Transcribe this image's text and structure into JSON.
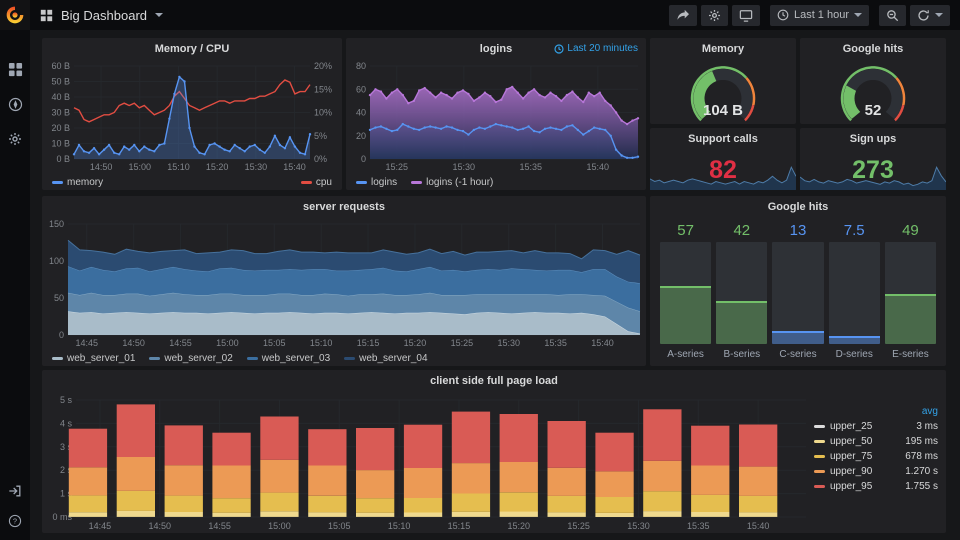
{
  "header": {
    "title": "Big Dashboard",
    "time_range": "Last 1 hour"
  },
  "sidebar": {
    "top_icons": [
      "apps-grid",
      "explore-compass",
      "settings-gear"
    ],
    "bottom_icons": [
      "sign-in",
      "help"
    ]
  },
  "colors": {
    "accent_blue": "#33a2e8",
    "green": "#73BF69",
    "blue": "#5794F2",
    "red": "#E24D42"
  },
  "chart_data": {
    "memory_cpu": {
      "type": "line",
      "title": "Memory / CPU",
      "x_start": "14:43",
      "x_end": "15:44",
      "x_ticks": [
        "14:50",
        "15:00",
        "15:10",
        "15:20",
        "15:30",
        "15:40"
      ],
      "y_left": {
        "ticks": [
          "0 B",
          "10 B",
          "20 B",
          "30 B",
          "40 B",
          "50 B",
          "60 B"
        ],
        "min": 0,
        "max": 60
      },
      "y_right": {
        "ticks": [
          "0%",
          "5%",
          "10%",
          "15%",
          "20%"
        ],
        "min": 0,
        "max": 20
      },
      "series": [
        {
          "name": "memory",
          "axis": "left",
          "color": "#5794F2",
          "fill": "rgba(87,148,242,0.28)",
          "points": true,
          "values": [
            3,
            9,
            5,
            4,
            7,
            3,
            6,
            9,
            4,
            3,
            8,
            6,
            9,
            5,
            8,
            6,
            5,
            9,
            10,
            26,
            42,
            53,
            50,
            20,
            8,
            4,
            3,
            9,
            10,
            8,
            6,
            5,
            9,
            7,
            5,
            8,
            9,
            6,
            4,
            8,
            15,
            9,
            7,
            14,
            8,
            4,
            3,
            16
          ]
        },
        {
          "name": "cpu",
          "axis": "right",
          "color": "#E24D42",
          "values": [
            11,
            10.5,
            8.5,
            8,
            8.5,
            9,
            9.5,
            9.5,
            10,
            11.5,
            12,
            11.5,
            12,
            11,
            11.5,
            10.5,
            9.5,
            10,
            10.5,
            11.5,
            13.5,
            14.5,
            13,
            11.5,
            11,
            10.5,
            11,
            11.5,
            12,
            12.5,
            12.5,
            12,
            12.5,
            12.5,
            12.5,
            13,
            13,
            13.5,
            13.5,
            14,
            14.5,
            16,
            17,
            16.5,
            14,
            14.5,
            14.5,
            16
          ]
        }
      ]
    },
    "logins": {
      "type": "line",
      "title": "logins",
      "header_note": "Last 20 minutes",
      "x_start": "15:23",
      "x_end": "15:43",
      "x_ticks": [
        "15:25",
        "15:30",
        "15:35",
        "15:40"
      ],
      "y_left": {
        "ticks": [
          "0",
          "20",
          "40",
          "60",
          "80"
        ],
        "min": 0,
        "max": 80
      },
      "series": [
        {
          "name": "logins",
          "color": "#5794F2",
          "points": true,
          "fill": "rgba(87,148,242,0.10)",
          "values": [
            25,
            27,
            28,
            26,
            24,
            25,
            30,
            28,
            26,
            25,
            27,
            28,
            27,
            26,
            28,
            27,
            25,
            24,
            21,
            25,
            27,
            26,
            28,
            30,
            29,
            28,
            27,
            25,
            26,
            28,
            24,
            23,
            26,
            27,
            26,
            25,
            28,
            29,
            25,
            21,
            24,
            27,
            26,
            25,
            20,
            8,
            3,
            1,
            1,
            2
          ]
        },
        {
          "name": "logins (-1 hour)",
          "color": "#B877D9",
          "points": true,
          "gradient": [
            "rgba(184,119,217,0.80)",
            "rgba(32,44,78,0.90)"
          ],
          "values": [
            55,
            60,
            58,
            52,
            57,
            60,
            55,
            48,
            50,
            59,
            61,
            57,
            53,
            57,
            55,
            52,
            57,
            59,
            56,
            50,
            53,
            57,
            54,
            49,
            51,
            60,
            62,
            57,
            52,
            57,
            60,
            55,
            53,
            57,
            54,
            50,
            55,
            58,
            53,
            49,
            57,
            54,
            57,
            50,
            46,
            40,
            33,
            30,
            33,
            35
          ]
        }
      ]
    },
    "memory_gauge": {
      "type": "gauge",
      "title": "Memory",
      "value": "104 B",
      "fraction": 0.42,
      "color": "#73BF69",
      "thresholds": [
        {
          "upto": 0.68,
          "color": "#73BF69"
        },
        {
          "upto": 0.88,
          "color": "#EF843C"
        },
        {
          "upto": 1,
          "color": "#E24D42"
        }
      ]
    },
    "google_gauge": {
      "type": "gauge",
      "title": "Google hits",
      "value": "52",
      "fraction": 0.26,
      "color": "#73BF69",
      "thresholds": [
        {
          "upto": 0.68,
          "color": "#73BF69"
        },
        {
          "upto": 0.88,
          "color": "#EF843C"
        },
        {
          "upto": 1,
          "color": "#E24D42"
        }
      ]
    },
    "support_calls": {
      "type": "stat",
      "title": "Support calls",
      "value": "82",
      "value_color": "#E02F44",
      "spark_line": "#4E7CA8",
      "spark_fill": "rgba(32,55,82,0.9)",
      "spark": [
        7,
        5,
        6,
        4,
        5,
        6,
        5,
        4,
        6,
        7,
        6,
        5,
        4,
        3,
        5,
        4,
        3,
        4,
        5,
        3,
        5,
        4,
        3,
        5,
        4,
        6,
        9,
        6,
        4,
        6,
        16,
        9
      ]
    },
    "sign_ups": {
      "type": "stat",
      "title": "Sign ups",
      "value": "273",
      "value_color": "#73BF69",
      "spark_line": "#4E7CA8",
      "spark_fill": "rgba(32,55,82,0.9)",
      "spark": [
        9,
        6,
        5,
        7,
        5,
        4,
        6,
        5,
        4,
        5,
        7,
        6,
        4,
        5,
        6,
        5,
        4,
        3,
        5,
        4,
        6,
        5,
        3,
        4,
        2,
        3,
        5,
        4,
        6,
        17,
        10,
        5
      ]
    },
    "server_requests": {
      "type": "stacked_area",
      "title": "server requests",
      "x_start": "14:43",
      "x_end": "15:44",
      "x_ticks": [
        "14:45",
        "14:50",
        "14:55",
        "15:00",
        "15:05",
        "15:10",
        "15:15",
        "15:20",
        "15:25",
        "15:30",
        "15:35",
        "15:40"
      ],
      "y_left": {
        "ticks": [
          "0",
          "50",
          "100",
          "150"
        ],
        "min": 0,
        "max": 150
      },
      "series": [
        {
          "name": "web_server_01",
          "color": "#A9BCC9",
          "edge": "#CBD9E2",
          "values": [
            32,
            30,
            31,
            29,
            30,
            31,
            30,
            29,
            30,
            31,
            30,
            30,
            29,
            30,
            31,
            30,
            29,
            30,
            30,
            31,
            30,
            29,
            30,
            30,
            29,
            30,
            31,
            30,
            29,
            30,
            30,
            31,
            30,
            29,
            28,
            30,
            31,
            30,
            29,
            30,
            31,
            30,
            30,
            29,
            30,
            28,
            25,
            15,
            5,
            2
          ]
        },
        {
          "name": "web_server_02",
          "color": "#5E86A9",
          "edge": "#86A9C4",
          "values": [
            25,
            24,
            26,
            25,
            24,
            25,
            26,
            24,
            25,
            26,
            25,
            24,
            25,
            26,
            25,
            24,
            25,
            24,
            26,
            25,
            24,
            25,
            26,
            25,
            24,
            25,
            24,
            26,
            25,
            24,
            25,
            26,
            24,
            25,
            26,
            25,
            24,
            25,
            26,
            25,
            24,
            25,
            24,
            26,
            25,
            26,
            28,
            30,
            32,
            30
          ]
        },
        {
          "name": "web_server_03",
          "color": "#3B6E9F",
          "edge": "#5E8FBE",
          "values": [
            36,
            33,
            35,
            34,
            32,
            34,
            35,
            33,
            34,
            35,
            34,
            33,
            32,
            34,
            35,
            34,
            33,
            34,
            32,
            33,
            34,
            35,
            33,
            32,
            34,
            33,
            34,
            35,
            33,
            32,
            34,
            35,
            33,
            34,
            32,
            33,
            34,
            33,
            35,
            34,
            33,
            32,
            34,
            33,
            30,
            35,
            36,
            34,
            35,
            38
          ]
        },
        {
          "name": "web_server_04",
          "color": "#2B4B71",
          "edge": "#46719C",
          "values": [
            35,
            28,
            22,
            24,
            23,
            26,
            22,
            25,
            24,
            22,
            26,
            23,
            25,
            22,
            24,
            26,
            23,
            22,
            25,
            26,
            24,
            23,
            22,
            25,
            24,
            23,
            22,
            24,
            25,
            23,
            22,
            24,
            23,
            25,
            22,
            24,
            23,
            25,
            24,
            22,
            26,
            24,
            23,
            22,
            18,
            26,
            25,
            30,
            42,
            38
          ]
        }
      ]
    },
    "google_hits_bars": {
      "type": "bargauge",
      "title": "Google hits",
      "max": 100,
      "bars": [
        {
          "label": "A-series",
          "value": "57",
          "frac": 0.57,
          "color": "#73BF69",
          "fill": "rgba(115,191,105,0.40)"
        },
        {
          "label": "B-series",
          "value": "42",
          "frac": 0.42,
          "color": "#73BF69",
          "fill": "rgba(115,191,105,0.40)"
        },
        {
          "label": "C-series",
          "value": "13",
          "frac": 0.13,
          "color": "#5794F2",
          "fill": "rgba(87,148,242,0.45)"
        },
        {
          "label": "D-series",
          "value": "7.5",
          "frac": 0.075,
          "color": "#5794F2",
          "fill": "rgba(87,148,242,0.45)"
        },
        {
          "label": "E-series",
          "value": "49",
          "frac": 0.49,
          "color": "#73BF69",
          "fill": "rgba(115,191,105,0.40)"
        }
      ]
    },
    "client_load": {
      "type": "stacked_bar",
      "title": "client side full page load",
      "x_start": "14:43",
      "x_end": "15:44",
      "bar_interval": 4,
      "x_ticks": [
        "14:45",
        "14:50",
        "14:55",
        "15:00",
        "15:05",
        "15:10",
        "15:15",
        "15:20",
        "15:25",
        "15:30",
        "15:35",
        "15:40"
      ],
      "bar_times": [
        "14:44",
        "14:48",
        "14:52",
        "14:56",
        "15:00",
        "15:04",
        "15:08",
        "15:12",
        "15:16",
        "15:20",
        "15:24",
        "15:28",
        "15:32",
        "15:36",
        "15:40"
      ],
      "y_left": {
        "ticks": [
          "0 ms",
          "1 s",
          "2 s",
          "3 s",
          "4 s",
          "5 s"
        ],
        "min": 0,
        "max": 5
      },
      "series": [
        {
          "name": "upper_25",
          "color": "#DCDCDC",
          "values": [
            0.003,
            0.003,
            0.003,
            0.003,
            0.003,
            0.003,
            0.003,
            0.003,
            0.003,
            0.003,
            0.003,
            0.003,
            0.003,
            0.003,
            0.003
          ]
        },
        {
          "name": "upper_50",
          "color": "#EFD98E",
          "values": [
            0.2,
            0.26,
            0.21,
            0.18,
            0.24,
            0.2,
            0.18,
            0.19,
            0.22,
            0.23,
            0.2,
            0.17,
            0.25,
            0.21,
            0.2
          ]
        },
        {
          "name": "upper_75",
          "color": "#E5BE4F",
          "values": [
            0.72,
            0.85,
            0.7,
            0.62,
            0.8,
            0.7,
            0.62,
            0.62,
            0.78,
            0.82,
            0.7,
            0.68,
            0.85,
            0.73,
            0.7
          ]
        },
        {
          "name": "upper_90",
          "color": "#EC9A55",
          "values": [
            1.2,
            1.45,
            1.3,
            1.4,
            1.4,
            1.3,
            1.2,
            1.28,
            1.3,
            1.3,
            1.2,
            1.1,
            1.3,
            1.26,
            1.25
          ]
        },
        {
          "name": "upper_95",
          "color": "#D95B55",
          "values": [
            1.65,
            2.25,
            1.7,
            1.4,
            1.85,
            1.55,
            1.8,
            1.85,
            2.2,
            2.05,
            2.0,
            1.65,
            2.2,
            1.7,
            1.8
          ]
        }
      ],
      "legend": {
        "header": "avg",
        "rows": [
          [
            "upper_25",
            "#DCDCDC",
            "3 ms"
          ],
          [
            "upper_50",
            "#EFD98E",
            "195 ms"
          ],
          [
            "upper_75",
            "#E5BE4F",
            "678 ms"
          ],
          [
            "upper_90",
            "#EC9A55",
            "1.270 s"
          ],
          [
            "upper_95",
            "#D95B55",
            "1.755 s"
          ]
        ]
      }
    }
  }
}
